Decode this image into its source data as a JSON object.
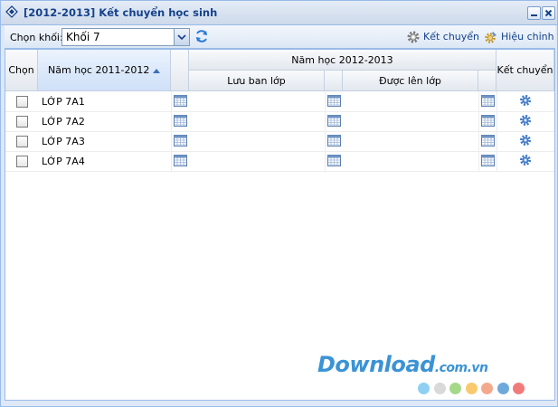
{
  "window": {
    "title": "[2012-2013] Kết chuyển học sinh"
  },
  "toolbar": {
    "select_label": "Chọn khối:",
    "select_value": "Khối 7",
    "transfer_label": "Kết chuyển",
    "edit_label": "Hiệu chỉnh"
  },
  "grid": {
    "headers": {
      "select": "Chọn",
      "year_old": "Năm học 2011-2012",
      "year_new": "Năm học 2012-2013",
      "retain": "Lưu ban lớp",
      "promote": "Được lên lớp",
      "transfer": "Kết chuyển"
    },
    "rows": [
      {
        "class": "LỚP 7A1"
      },
      {
        "class": "LỚP 7A2"
      },
      {
        "class": "LỚP 7A3"
      },
      {
        "class": "LỚP 7A4"
      }
    ]
  },
  "watermark": {
    "main": "Download",
    "suffix": ".com.vn"
  },
  "colors": {
    "dots": [
      "#8dd0f2",
      "#d9d9d9",
      "#a6d889",
      "#f9c96e",
      "#f4a98d",
      "#6ea9dc",
      "#f17b7b"
    ]
  }
}
